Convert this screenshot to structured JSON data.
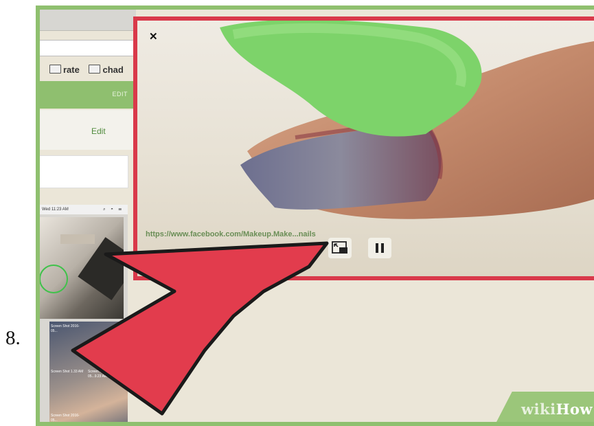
{
  "step": {
    "number": "8."
  },
  "browser": {
    "bookmarks": [
      "rate",
      "chad"
    ],
    "header_edit_label": "EDIT",
    "edit_link": "Edit"
  },
  "thumbnail": {
    "menubar_time": "Wed 11:23 AM",
    "tiles": [
      "Screen Shot 2016-05...",
      "Screen Shot 2016-05...9.23 AM",
      "Screen Shot 1.33 AM",
      "Screen Shot 2016-05..."
    ]
  },
  "pip_player": {
    "close_icon": "close-icon",
    "url_overlay": "https://www.facebook.com/Makeup.Make...nails",
    "exit_pip_icon": "exit-picture-in-picture-icon",
    "pause_icon": "pause-icon"
  },
  "colors": {
    "highlight_border": "#d9394a",
    "arrow_fill": "#e23c4d",
    "frame_green": "#8fc06f",
    "url_green": "#6a8e56"
  },
  "branding": {
    "wiki": "wiki",
    "how": "How"
  }
}
